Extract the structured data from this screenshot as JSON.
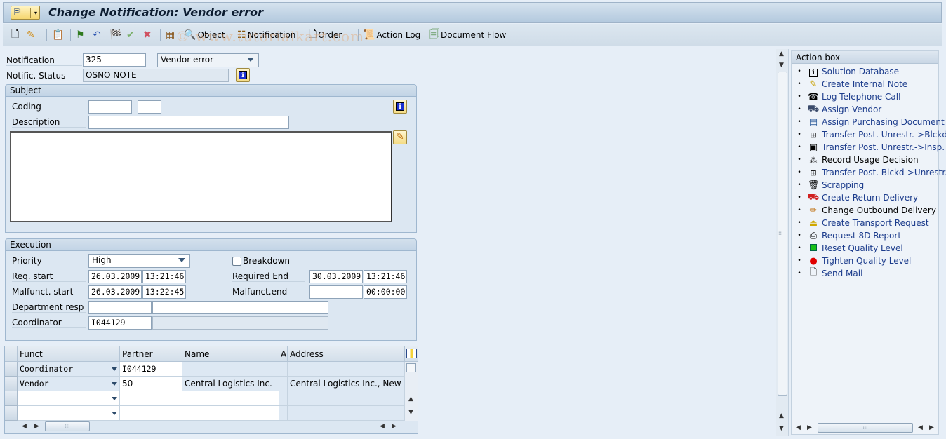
{
  "window": {
    "title": "Change Notification: Vendor error",
    "menu_icon": "sap-menu-icon"
  },
  "toolbar": {
    "icons": [
      "new-document-icon",
      "edit-pencil-icon",
      "clipboard-icon",
      "green-flag-icon",
      "undo-icon",
      "checkered-flag-icon",
      "approve-icon",
      "reject-icon",
      "display-icon"
    ],
    "object_label": "Object",
    "notification_label": "Notification",
    "order_label": "Order",
    "action_log_label": "Action Log",
    "document_flow_label": "Document Flow"
  },
  "watermark": "© www.tutorialkart.com",
  "header": {
    "notification_label": "Notification",
    "notification_value": "325",
    "notification_type": "Vendor error",
    "status_label": "Notific. Status",
    "status_value": "OSNO NOTE"
  },
  "subject": {
    "title": "Subject",
    "coding_label": "Coding",
    "coding_value1": "",
    "coding_value2": "",
    "description_label": "Description",
    "description_value": "",
    "long_text": ""
  },
  "execution": {
    "title": "Execution",
    "priority_label": "Priority",
    "priority_value": "High",
    "breakdown_label": "Breakdown",
    "breakdown_checked": false,
    "req_start_label": "Req. start",
    "req_start_date": "26.03.2009",
    "req_start_time": "13:21:46",
    "required_end_label": "Required End",
    "required_end_date": "30.03.2009",
    "required_end_time": "13:21:46",
    "malf_start_label": "Malfunct. start",
    "malf_start_date": "26.03.2009",
    "malf_start_time": "13:22:45",
    "malf_end_label": "Malfunct.end",
    "malf_end_date": "",
    "malf_end_time": "00:00:00",
    "dept_label": "Department resp",
    "dept_value": "",
    "dept_desc": "",
    "coordinator_label": "Coordinator",
    "coordinator_value": "I044129",
    "coordinator_desc": ""
  },
  "partners": {
    "columns": [
      "Funct",
      "Partner",
      "Name",
      "A",
      "Address"
    ],
    "rows": [
      {
        "funct": "Coordinator",
        "partner": "I044129",
        "name": "",
        "a": "",
        "address": ""
      },
      {
        "funct": "Vendor",
        "partner": "50",
        "name": "Central Logistics Inc.",
        "a": "",
        "address": "Central Logistics Inc., New Yo"
      },
      {
        "funct": "",
        "partner": "",
        "name": "",
        "a": "",
        "address": ""
      },
      {
        "funct": "",
        "partner": "",
        "name": "",
        "a": "",
        "address": ""
      }
    ]
  },
  "action_box": {
    "title": "Action box",
    "items": [
      {
        "label": "Solution Database",
        "icon": "info-icon",
        "link": true
      },
      {
        "label": "Create Internal Note",
        "icon": "note-pencil-icon",
        "link": true
      },
      {
        "label": "Log Telephone Call",
        "icon": "telephone-icon",
        "link": true
      },
      {
        "label": "Assign Vendor",
        "icon": "vendor-icon",
        "link": true
      },
      {
        "label": "Assign Purchasing Document",
        "icon": "purchasing-document-icon",
        "link": true
      },
      {
        "label": "Transfer Post. Unrestr.->Blckd",
        "icon": "transfer-icon",
        "link": true
      },
      {
        "label": "Transfer Post. Unrestr.->Insp.",
        "icon": "inspection-transfer-icon",
        "link": true
      },
      {
        "label": "Record Usage Decision",
        "icon": "usage-decision-icon",
        "link": false
      },
      {
        "label": "Transfer Post. Blckd->Unrestr.",
        "icon": "transfer-icon",
        "link": true
      },
      {
        "label": "Scrapping",
        "icon": "trash-icon",
        "link": true
      },
      {
        "label": "Create Return Delivery",
        "icon": "truck-icon",
        "link": true
      },
      {
        "label": "Change Outbound Delivery",
        "icon": "pencil-icon",
        "link": false
      },
      {
        "label": "Create Transport Request",
        "icon": "transport-icon",
        "link": true
      },
      {
        "label": "Request 8D Report",
        "icon": "printer-icon",
        "link": true
      },
      {
        "label": "Reset Quality Level",
        "icon": "green-square-icon",
        "link": true
      },
      {
        "label": "Tighten Quality Level",
        "icon": "red-light-icon",
        "link": true
      },
      {
        "label": "Send Mail",
        "icon": "document-icon",
        "link": true
      }
    ]
  }
}
